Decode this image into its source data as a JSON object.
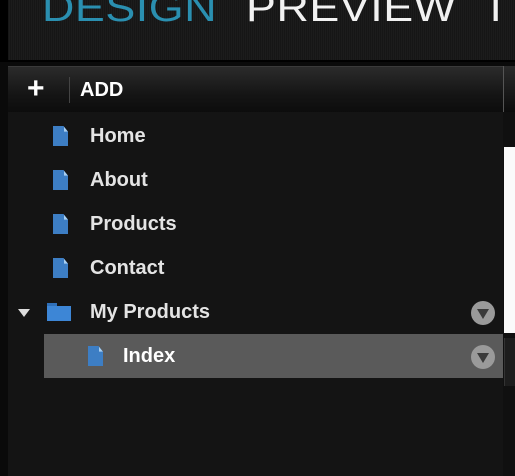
{
  "tabs": {
    "design": "DESIGN",
    "preview": "PREVIEW",
    "third": "T"
  },
  "toolbar": {
    "add_icon": "+",
    "add_label": "ADD"
  },
  "tree": {
    "items": [
      {
        "label": "Home",
        "icon": "page-icon"
      },
      {
        "label": "About",
        "icon": "page-icon"
      },
      {
        "label": "Products",
        "icon": "page-icon"
      },
      {
        "label": "Contact",
        "icon": "page-icon"
      },
      {
        "label": "My Products",
        "icon": "folder-icon",
        "expanded": true,
        "menu_icon": "chevron-menu-icon"
      },
      {
        "label": "Index",
        "icon": "page-icon",
        "selected": true,
        "menu_icon": "chevron-menu-icon"
      }
    ]
  },
  "colors": {
    "accent": "#2a8fb0",
    "icon_blue": "#3d7ec4",
    "selected_row": "#5a5a5a",
    "background": "#141414"
  }
}
